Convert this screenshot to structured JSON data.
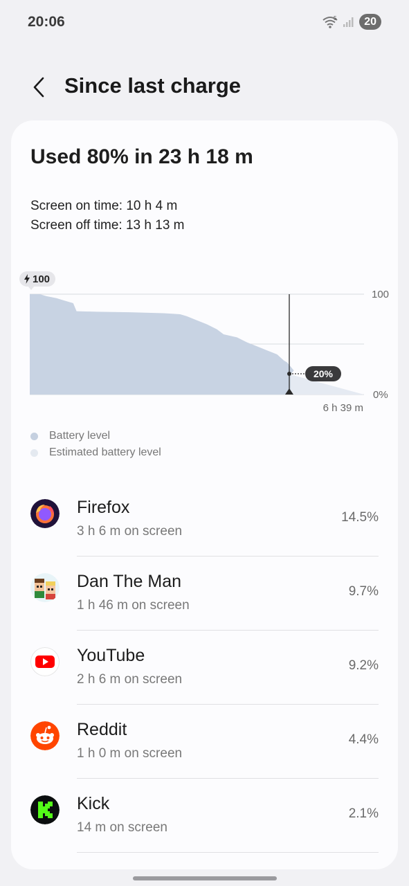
{
  "status": {
    "time": "20:06",
    "battery": "20",
    "network": "5"
  },
  "header": {
    "title": "Since last charge"
  },
  "summary": {
    "headline": "Used 80% in 23 h 18 m",
    "screen_on": "Screen on time: 10 h 4 m",
    "screen_off": "Screen off time: 13 h 13 m"
  },
  "chart_data": {
    "type": "area",
    "title": "",
    "charge_badge": "100",
    "y_max_label": "100",
    "y_min_label": "0%",
    "x_label": "6 h 39 m",
    "current_label": "20%",
    "ylim": [
      0,
      100
    ],
    "grid": true,
    "series": [
      {
        "name": "Battery level",
        "color": "#c8d3e3",
        "points": [
          [
            0,
            100
          ],
          [
            0.03,
            100
          ],
          [
            0.05,
            98
          ],
          [
            0.08,
            96
          ],
          [
            0.1,
            94
          ],
          [
            0.13,
            91
          ],
          [
            0.14,
            83
          ],
          [
            0.2,
            82.5
          ],
          [
            0.3,
            82
          ],
          [
            0.4,
            81
          ],
          [
            0.45,
            80
          ],
          [
            0.47,
            78
          ],
          [
            0.5,
            74
          ],
          [
            0.53,
            70
          ],
          [
            0.56,
            65
          ],
          [
            0.58,
            60
          ],
          [
            0.62,
            57
          ],
          [
            0.65,
            52
          ],
          [
            0.68,
            48
          ],
          [
            0.71,
            44
          ],
          [
            0.74,
            40
          ],
          [
            0.76,
            34
          ],
          [
            0.77,
            32
          ],
          [
            0.79,
            24
          ],
          [
            0.78,
            20
          ]
        ]
      },
      {
        "name": "Estimated battery level",
        "color": "#e5eaf2",
        "points": [
          [
            0.78,
            20
          ],
          [
            1.0,
            0
          ]
        ]
      }
    ]
  },
  "legend": [
    {
      "label": "Battery level",
      "color": "#c5d0e0"
    },
    {
      "label": "Estimated battery level",
      "color": "#e4e9f0"
    }
  ],
  "apps": [
    {
      "name": "Firefox",
      "sub": "3 h 6 m on screen",
      "pct": "14.5%",
      "icon": "firefox-icon"
    },
    {
      "name": "Dan The Man",
      "sub": "1 h 46 m on screen",
      "pct": "9.7%",
      "icon": "dan-the-man-icon"
    },
    {
      "name": "YouTube",
      "sub": "2 h 6 m on screen",
      "pct": "9.2%",
      "icon": "youtube-icon"
    },
    {
      "name": "Reddit",
      "sub": "1 h 0 m on screen",
      "pct": "4.4%",
      "icon": "reddit-icon"
    },
    {
      "name": "Kick",
      "sub": "14 m on screen",
      "pct": "2.1%",
      "icon": "kick-icon"
    }
  ]
}
